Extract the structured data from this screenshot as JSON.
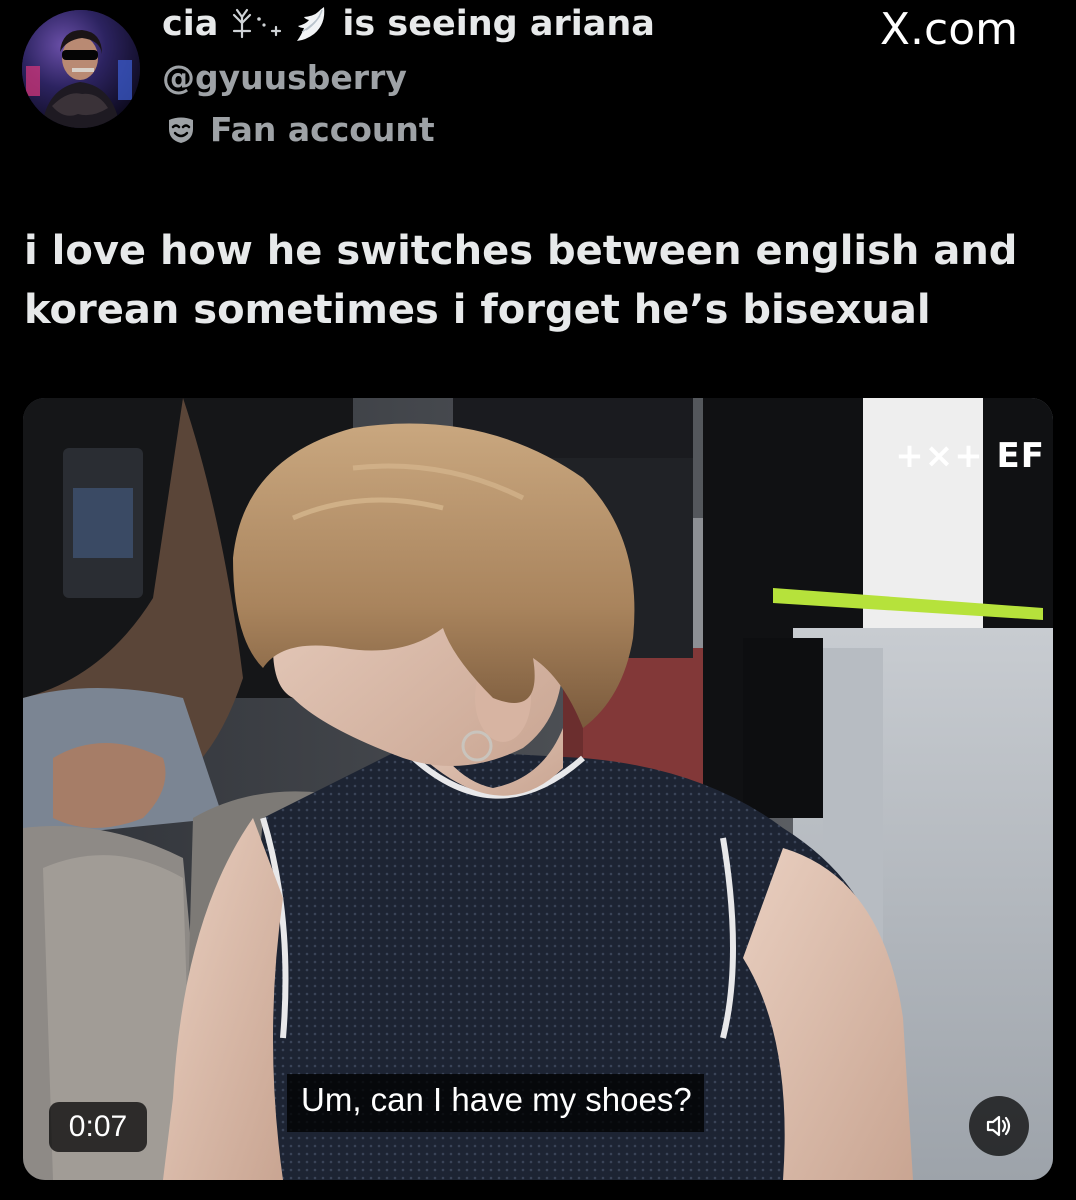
{
  "header": {
    "display_name": "cia",
    "status_text": "is seeing ariana",
    "handle": "@gyuusberry",
    "badge_label": "Fan account",
    "badge_icon": "mask-icon"
  },
  "site_label": "X.com",
  "tweet": {
    "text": "i love how he switches between english and korean sometimes i forget he’s bisexual"
  },
  "video": {
    "watermark": "+×+ EF",
    "subtitle": "Um, can I have my shoes?",
    "timestamp": "0:07",
    "mute_icon": "speaker-muted-icon"
  }
}
